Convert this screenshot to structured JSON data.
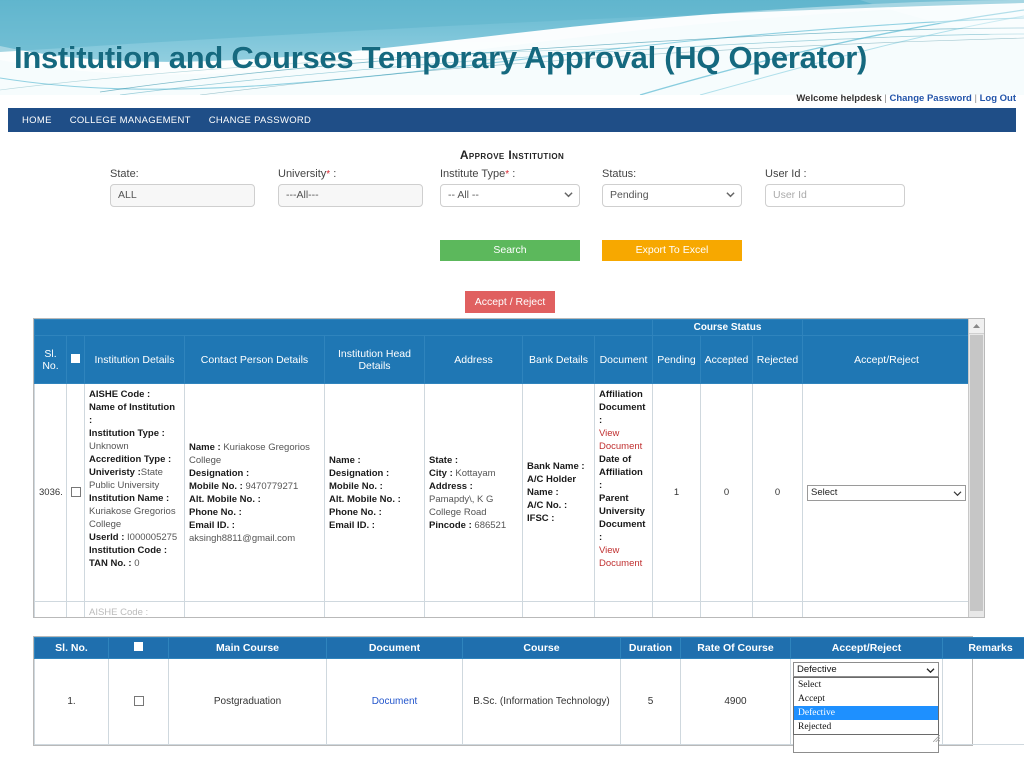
{
  "banner": {
    "title": "Institution and Courses Temporary Approval (HQ Operator)"
  },
  "topbar": {
    "welcome": "Welcome helpdesk",
    "change_password": "Change Password",
    "logout": "Log Out",
    "separator": "|"
  },
  "nav": {
    "items": [
      {
        "label": "HOME"
      },
      {
        "label": "COLLEGE MANAGEMENT"
      },
      {
        "label": "CHANGE PASSWORD"
      }
    ]
  },
  "form": {
    "heading": "Approve Institution",
    "required_mark": "*",
    "fields": [
      {
        "label": "State:",
        "value": "ALL",
        "type": "text"
      },
      {
        "label": "University",
        "value": "---All---",
        "type": "text",
        "required": true,
        "suffix": ":"
      },
      {
        "label": "Institute Type",
        "value": "-- All --",
        "type": "select",
        "required": true,
        "suffix": ":"
      },
      {
        "label": "Status:",
        "value": "Pending",
        "type": "select"
      },
      {
        "label": "User Id :",
        "value": "",
        "placeholder": "User Id",
        "type": "text"
      }
    ],
    "search_label": "Search",
    "export_label": "Export To Excel",
    "accept_reject_label": "Accept / Reject"
  },
  "grid": {
    "group_header": "Course Status",
    "columns": [
      "Sl. No.",
      "",
      "Institution Details",
      "Contact Person Details",
      "Institution Head Details",
      "Address",
      "Bank Details",
      "Document",
      "Pending",
      "Accepted",
      "Rejected",
      "Accept/Reject"
    ],
    "rows": [
      {
        "sl_no": "3036.",
        "institution_details": [
          {
            "k": "AISHE Code :",
            "v": ""
          },
          {
            "k": "Name of Institution :",
            "v": ""
          },
          {
            "k": "Institution Type :",
            "v": "Unknown"
          },
          {
            "k": "Accredition Type :",
            "v": ""
          },
          {
            "k": "Univeristy :",
            "v": "State Public University"
          },
          {
            "k": "Institution Name :",
            "v": "Kuriakose Gregorios College"
          },
          {
            "k": "UserId :",
            "v": "I000005275"
          },
          {
            "k": "Institution Code :",
            "v": ""
          },
          {
            "k": "TAN No. :",
            "v": "0"
          }
        ],
        "contact_person": [
          {
            "k": "Name :",
            "v": "Kuriakose Gregorios College"
          },
          {
            "k": "Designation :",
            "v": ""
          },
          {
            "k": "Mobile No. :",
            "v": "9470779271"
          },
          {
            "k": "Alt. Mobile No. :",
            "v": ""
          },
          {
            "k": "Phone No. :",
            "v": ""
          },
          {
            "k": "Email ID. :",
            "v": "aksingh8811@gmail.com"
          }
        ],
        "head_details": [
          {
            "k": "Name :",
            "v": ""
          },
          {
            "k": "Designation :",
            "v": ""
          },
          {
            "k": "Mobile No. :",
            "v": ""
          },
          {
            "k": "Alt. Mobile No. :",
            "v": ""
          },
          {
            "k": "Phone No. :",
            "v": ""
          },
          {
            "k": "Email ID. :",
            "v": ""
          }
        ],
        "address": [
          {
            "k": "State :",
            "v": ""
          },
          {
            "k": "City :",
            "v": "Kottayam"
          },
          {
            "k": "Address :",
            "v": "Pamapdy\\, K G College Road"
          },
          {
            "k": "Pincode :",
            "v": "686521"
          }
        ],
        "bank_details": [
          {
            "k": "Bank Name :",
            "v": ""
          },
          {
            "k": "A/C Holder Name :",
            "v": ""
          },
          {
            "k": "A/C No. :",
            "v": ""
          },
          {
            "k": "IFSC :",
            "v": ""
          }
        ],
        "document": [
          {
            "k": "Affiliation Document :",
            "v": ""
          },
          {
            "link": "View Document"
          },
          {
            "k": "Date of Affiliation :",
            "v": ""
          },
          {
            "k": "Parent University Document :",
            "v": ""
          },
          {
            "link": "View Document"
          }
        ],
        "pending": "1",
        "accepted": "0",
        "rejected": "0",
        "accept_reject_value": "Select"
      }
    ]
  },
  "course_table": {
    "columns": [
      "Sl. No.",
      "",
      "Main Course",
      "Document",
      "Course",
      "Duration",
      "Rate Of Course",
      "Accept/Reject",
      "Remarks"
    ],
    "rows": [
      {
        "sl_no": "1.",
        "main_course": "Postgraduation",
        "document": "Document",
        "course": "B.Sc. (Information Technology)",
        "duration": "5",
        "rate": "4900",
        "accept_reject_value": "Defective",
        "remarks": ""
      }
    ],
    "dropdown_options": [
      "Select",
      "Accept",
      "Defective",
      "Rejected"
    ],
    "dropdown_selected": "Defective"
  },
  "colors": {
    "banner_teal": "#15697f",
    "nav_blue": "#1f4e87",
    "grid_header_blue": "#1f77b4",
    "search_green": "#5cb85c",
    "export_orange": "#f7a800",
    "accept_red": "#e06060",
    "doc_link_red": "#c03030",
    "num_violet": "#3b3bd0",
    "highlight_blue": "#1e90ff"
  }
}
